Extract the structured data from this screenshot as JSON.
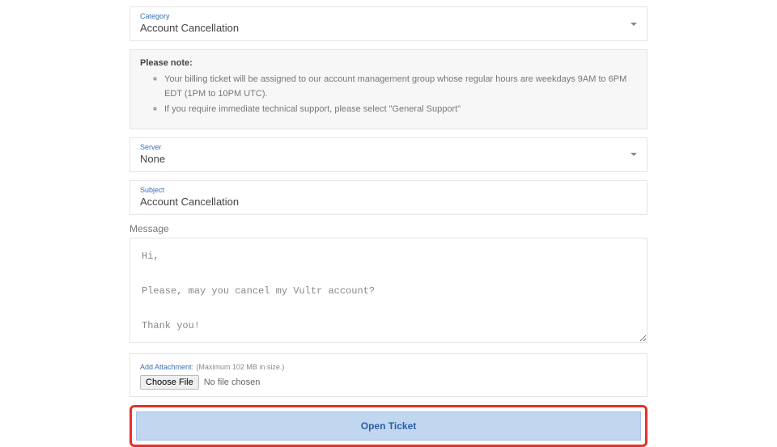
{
  "category": {
    "label": "Category",
    "value": "Account Cancellation"
  },
  "note": {
    "title": "Please note:",
    "items": [
      "Your billing ticket will be assigned to our account management group whose regular hours are weekdays 9AM to 6PM EDT (1PM to 10PM UTC).",
      "If you require immediate technical support, please select \"General Support\""
    ]
  },
  "server": {
    "label": "Server",
    "value": "None"
  },
  "subject": {
    "label": "Subject",
    "value": "Account Cancellation"
  },
  "message": {
    "label": "Message",
    "value": "Hi,\n\nPlease, may you cancel my Vultr account?\n\nThank you!"
  },
  "attachment": {
    "label": "Add Attachment:",
    "limit": "(Maximum 102 MB in size.)",
    "button": "Choose File",
    "status": "No file chosen"
  },
  "submit": {
    "label": "Open Ticket"
  }
}
